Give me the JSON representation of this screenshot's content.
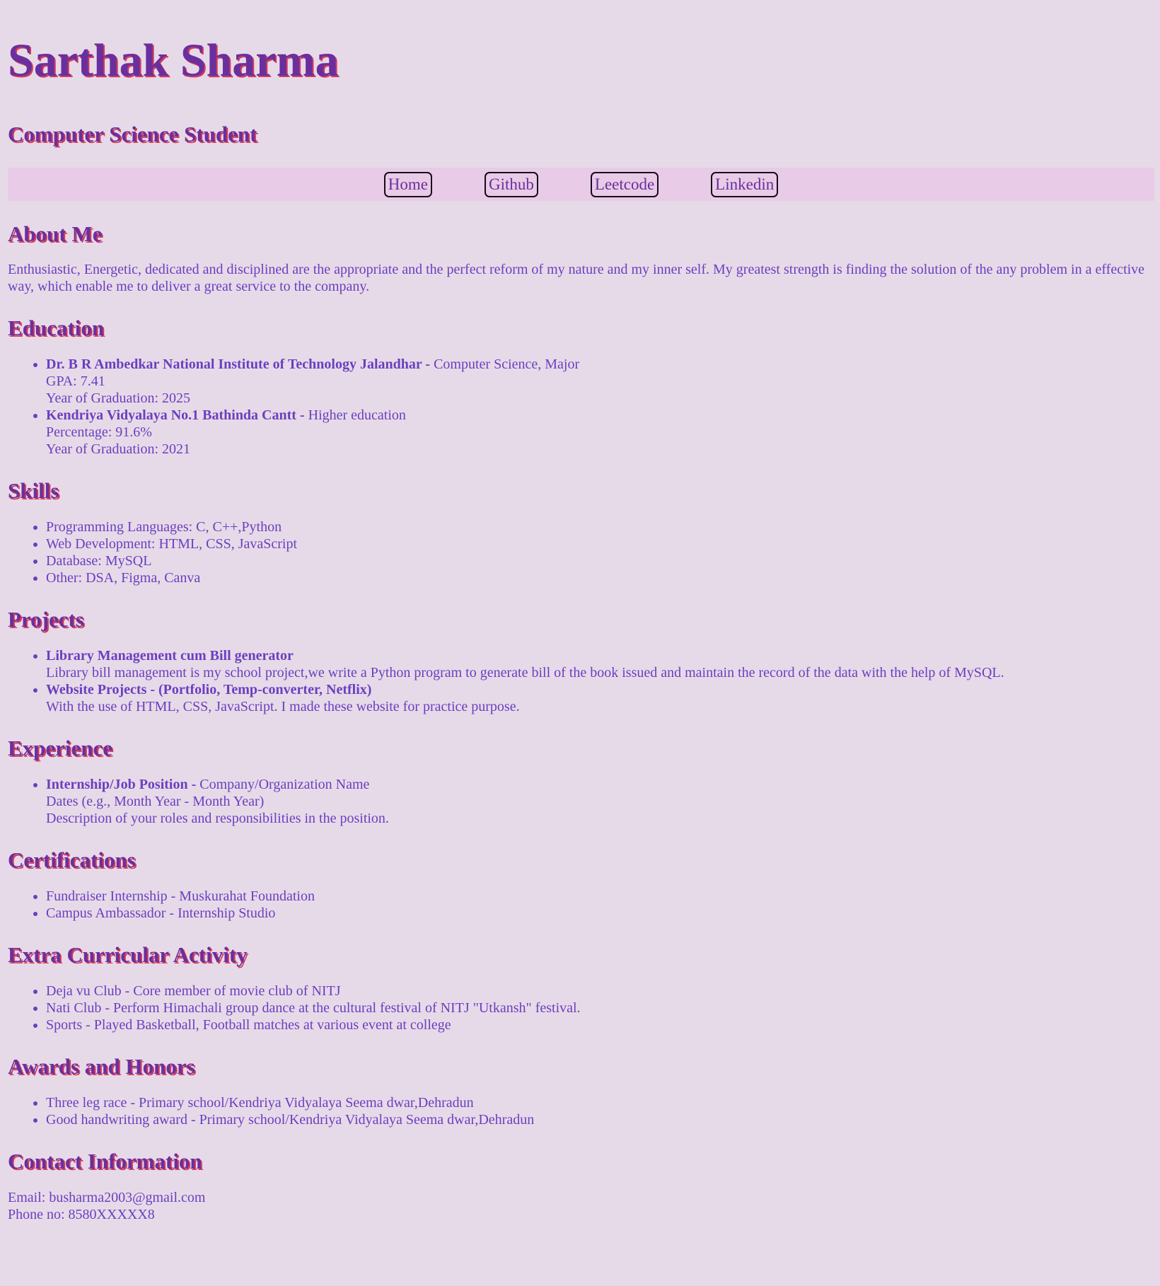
{
  "name": "Sarthak Sharma",
  "subtitle": "Computer Science Student",
  "nav": [
    "Home",
    "Github",
    "Leetcode",
    "Linkedin"
  ],
  "about": {
    "heading": "About Me",
    "text": "Enthusiastic, Energetic, dedicated and disciplined are the appropriate and the perfect reform of my nature and my inner self. My greatest strength is finding the solution of the any problem in a effective way, which enable me to deliver a great service to the company."
  },
  "education": {
    "heading": "Education",
    "items": [
      {
        "institution": "Dr. B R Ambedkar National Institute of Technology Jalandhar",
        "separator": " - ",
        "program": "Computer Science, Major",
        "score": "GPA: 7.41",
        "year": "Year of Graduation: 2025"
      },
      {
        "institution": "Kendriya Vidyalaya No.1 Bathinda Cantt",
        "separator": " - ",
        "program": "Higher education",
        "score": "Percentage: 91.6%",
        "year": "Year of Graduation: 2021"
      }
    ]
  },
  "skills": {
    "heading": "Skills",
    "items": [
      "Programming Languages: C, C++,Python",
      "Web Development: HTML, CSS, JavaScript",
      "Database: MySQL",
      "Other: DSA, Figma, Canva"
    ]
  },
  "projects": {
    "heading": "Projects",
    "items": [
      {
        "title": "Library Management cum Bill generator",
        "desc": "Library bill management is my school project,we write a Python program to generate bill of the book issued and maintain the record of the data with the help of MySQL."
      },
      {
        "title": "Website Projects - (Portfolio, Temp-converter, Netflix)",
        "desc": "With the use of HTML, CSS, JavaScript. I made these website for practice purpose."
      }
    ]
  },
  "experience": {
    "heading": "Experience",
    "items": [
      {
        "position": "Internship/Job Position",
        "separator": " - ",
        "company": "Company/Organization Name",
        "dates": "Dates (e.g., Month Year - Month Year)",
        "desc": "Description of your roles and responsibilities in the position."
      }
    ]
  },
  "certifications": {
    "heading": "Certifications",
    "items": [
      "Fundraiser Internship - Muskurahat Foundation",
      "Campus Ambassador - Internship Studio"
    ]
  },
  "extra": {
    "heading": "Extra Curricular Activity",
    "items": [
      "Deja vu Club - Core member of movie club of NITJ",
      "Nati Club - Perform Himachali group dance at the cultural festival of NITJ \"Utkansh\" festival.",
      "Sports - Played Basketball, Football matches at various event at college"
    ]
  },
  "awards": {
    "heading": "Awards and Honors",
    "items": [
      "Three leg race - Primary school/Kendriya Vidyalaya Seema dwar,Dehradun",
      "Good handwriting award - Primary school/Kendriya Vidyalaya Seema dwar,Dehradun"
    ]
  },
  "contact": {
    "heading": "Contact Information",
    "email": "Email: busharma2003@gmail.com",
    "phone": "Phone no: 8580XXXXX8"
  },
  "colors": {
    "background": "#e7dae8",
    "nav_background": "#e8cbe6",
    "heading": "#6a2f9e",
    "heading_shadow": "#d43a5a",
    "text": "#6a3fc0"
  }
}
